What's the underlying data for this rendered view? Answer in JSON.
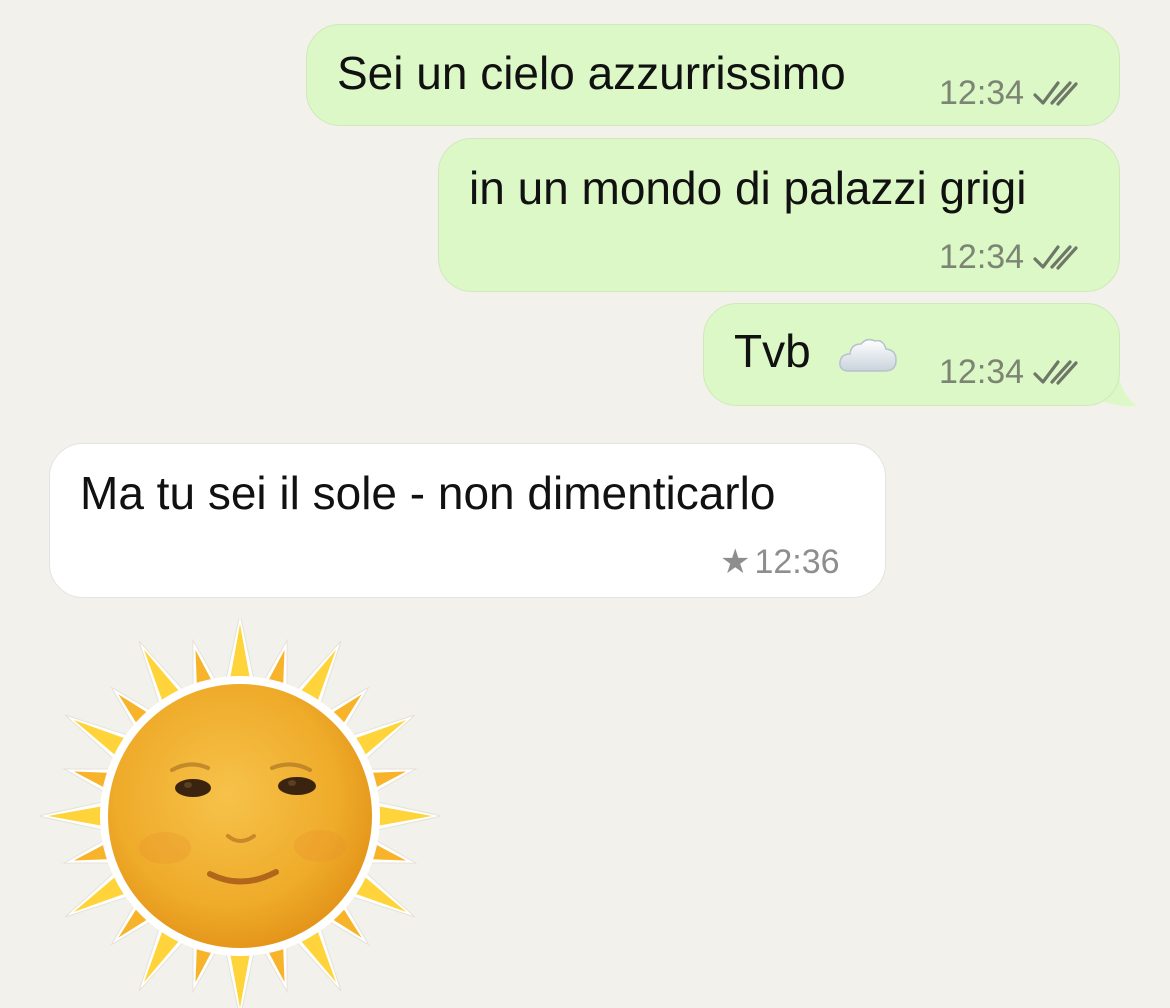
{
  "messages": [
    {
      "direction": "outgoing",
      "text": "Sei un cielo azzurrissimo",
      "time": "12:34",
      "status_icon": "double-check-icon"
    },
    {
      "direction": "outgoing",
      "text": "in un mondo di palazzi grigi",
      "time": "12:34",
      "status_icon": "double-check-icon"
    },
    {
      "direction": "outgoing",
      "text": "Tvb",
      "emoji": "cloud-emoji",
      "time": "12:34",
      "status_icon": "double-check-icon"
    },
    {
      "direction": "incoming",
      "text": "Ma tu sei il sole - non dimenticarlo",
      "time": "12:36",
      "starred": true,
      "star": "★"
    }
  ],
  "sticker": {
    "name": "sun-face-sticker"
  },
  "colors": {
    "background": "#f3f1ec",
    "outgoing_bubble": "#dcf8c6",
    "incoming_bubble": "#ffffff",
    "meta_text": "#7c8473"
  }
}
